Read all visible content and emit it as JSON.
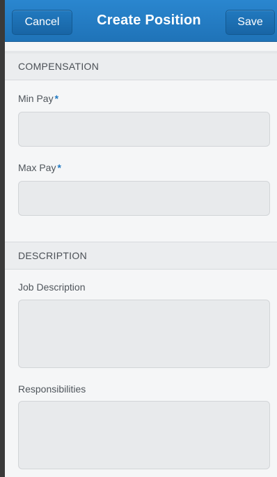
{
  "header": {
    "cancel_label": "Cancel",
    "title": "Create Position",
    "save_label": "Save"
  },
  "sections": {
    "compensation": {
      "title": "COMPENSATION",
      "min_pay_label": "Min Pay",
      "max_pay_label": "Max Pay",
      "required_marker": "*",
      "min_pay_value": "",
      "max_pay_value": ""
    },
    "description": {
      "title": "DESCRIPTION",
      "job_description_label": "Job Description",
      "responsibilities_label": "Responsibilities",
      "job_description_value": "",
      "responsibilities_value": ""
    }
  },
  "colors": {
    "header_blue": "#2a86cf",
    "required_star": "#1f78c2"
  }
}
